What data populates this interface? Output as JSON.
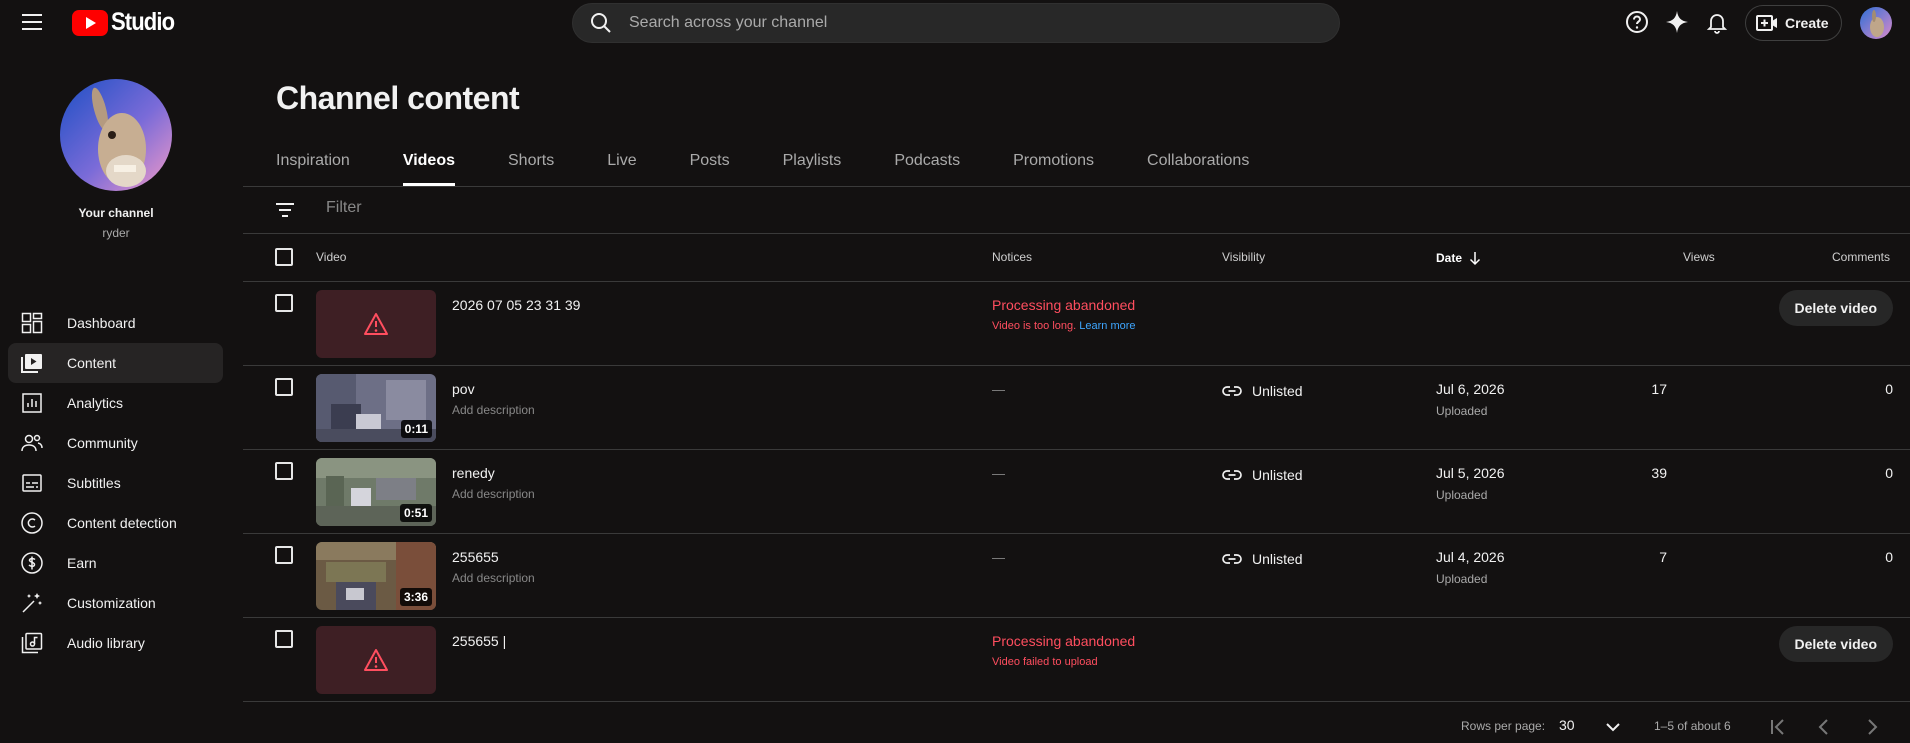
{
  "header": {
    "logo_text": "Studio",
    "search_placeholder": "Search across your channel",
    "create_label": "Create"
  },
  "sidebar": {
    "channel_title": "Your channel",
    "channel_handle": "ryder",
    "items": [
      {
        "label": "Dashboard",
        "icon": "dashboard-icon"
      },
      {
        "label": "Content",
        "icon": "content-icon",
        "active": true
      },
      {
        "label": "Analytics",
        "icon": "analytics-icon"
      },
      {
        "label": "Community",
        "icon": "community-icon"
      },
      {
        "label": "Subtitles",
        "icon": "subtitles-icon"
      },
      {
        "label": "Content detection",
        "icon": "copyright-icon"
      },
      {
        "label": "Earn",
        "icon": "earn-icon"
      },
      {
        "label": "Customization",
        "icon": "customization-icon"
      },
      {
        "label": "Audio library",
        "icon": "audio-library-icon"
      }
    ]
  },
  "main": {
    "title": "Channel content",
    "tabs": [
      "Inspiration",
      "Videos",
      "Shorts",
      "Live",
      "Posts",
      "Playlists",
      "Podcasts",
      "Promotions",
      "Collaborations"
    ],
    "active_tab": "Videos",
    "filter_placeholder": "Filter",
    "columns": {
      "video": "Video",
      "notices": "Notices",
      "visibility": "Visibility",
      "date": "Date",
      "views": "Views",
      "comments": "Comments"
    },
    "rows": [
      {
        "title": "2026 07 05 23 31 39",
        "error": true,
        "notice": "Processing abandoned",
        "notice_detail": "Video is too long.",
        "notice_link": "Learn more",
        "action": "Delete video"
      },
      {
        "title": "pov",
        "description": "Add description",
        "duration": "0:11",
        "notice": "—",
        "visibility": "Unlisted",
        "date": "Jul 6, 2026",
        "date_status": "Uploaded",
        "views": "17",
        "comments": "0"
      },
      {
        "title": "renedy",
        "description": "Add description",
        "duration": "0:51",
        "notice": "—",
        "visibility": "Unlisted",
        "date": "Jul 5, 2026",
        "date_status": "Uploaded",
        "views": "39",
        "comments": "0"
      },
      {
        "title": "255655",
        "description": "Add description",
        "duration": "3:36",
        "notice": "—",
        "visibility": "Unlisted",
        "date": "Jul 4, 2026",
        "date_status": "Uploaded",
        "views": "7",
        "comments": "0"
      },
      {
        "title": "255655 |",
        "error": true,
        "notice": "Processing abandoned",
        "notice_detail": "Video failed to upload",
        "action": "Delete video"
      }
    ]
  },
  "pagination": {
    "rows_label": "Rows per page:",
    "rows_value": "30",
    "range": "1–5 of about 6"
  },
  "colors": {
    "background": "#131111",
    "error": "#ff4e5f",
    "link": "#3ea6ff",
    "brand_red": "#ff0000"
  }
}
